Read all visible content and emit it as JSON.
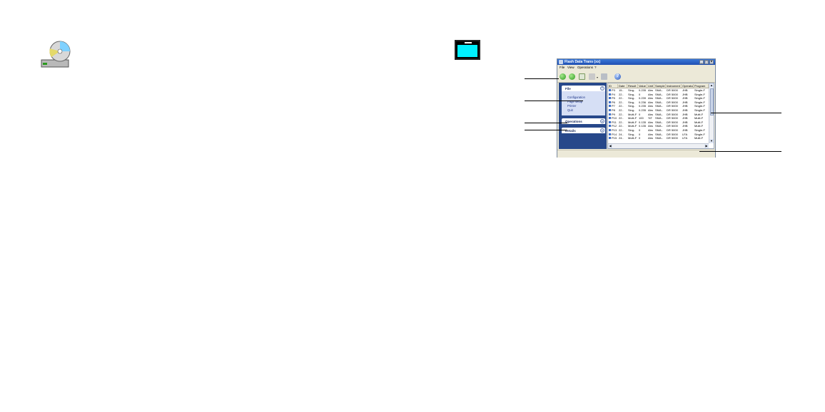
{
  "window": {
    "title": "Flash Data Trans (xx)"
  },
  "menu": [
    "File",
    "View",
    "Operations",
    "?"
  ],
  "nav": {
    "file_group": {
      "label": "File",
      "items": [
        "Configuration",
        "Page setup",
        "Printer",
        "Quit"
      ]
    },
    "operations_group": {
      "label": "Operations"
    },
    "details_group": {
      "label": "Details"
    }
  },
  "table": {
    "columns": [
      "ID",
      "Date",
      "Result",
      "Value",
      "Unit",
      "Sample",
      "Instrument",
      "Operator",
      "Program"
    ],
    "rows": [
      [
        "P3",
        "15..",
        "Sing..",
        "0.235",
        "Abs",
        "SMA..",
        "DR 5000",
        "JHB",
        "Single-F"
      ],
      [
        "P4",
        "22..",
        "Sing..",
        "0",
        "Abs",
        "SMA..",
        "DR 5000",
        "JHB",
        "Single-F"
      ],
      [
        "P5",
        "22..",
        "Sing..",
        "0.239",
        "Abs",
        "SMA..",
        "DR 5000",
        "JHB",
        "Single-F"
      ],
      [
        "P6",
        "22..",
        "Sing..",
        "0.236",
        "Abs",
        "SMA..",
        "DR 5000",
        "JHB",
        "Single-F"
      ],
      [
        "P7",
        "22..",
        "Sing..",
        "0.235",
        "Abs",
        "SMA..",
        "DR 5000",
        "JHB",
        "Single-F"
      ],
      [
        "P8",
        "22..",
        "Sing..",
        "0.235",
        "Abs",
        "SMA..",
        "DR 5000",
        "JHB",
        "Single-F"
      ],
      [
        "P9",
        "22..",
        "Multi-F",
        "0",
        "Abs",
        "SMA..",
        "DR 5000",
        "JHB",
        "Multi-F"
      ],
      [
        "P10",
        "22..",
        "Multi-F",
        "100",
        "%T",
        "SMA..",
        "DR 5000",
        "JHB",
        "Multi-F"
      ],
      [
        "P11",
        "22..",
        "Multi-F",
        "0.135",
        "Abs",
        "SMA..",
        "DR 5000",
        "JHB",
        "Multi-F"
      ],
      [
        "P12",
        "22..",
        "Multi-F",
        "0.135",
        "Abs",
        "SMA..",
        "DR 5000",
        "JHB",
        "Multi-F"
      ],
      [
        "P13",
        "22..",
        "Sing..",
        "0",
        "Abs",
        "SMA..",
        "DR 5000",
        "JHB",
        "Single-F"
      ],
      [
        "P14",
        "24..",
        "Sing..",
        "0",
        "Abs",
        "SMA..",
        "DR 5000",
        "LFA",
        "Single-F"
      ],
      [
        "P15",
        "24..",
        "Multi-F",
        "0",
        "Abs",
        "SMA..",
        "DR 5000",
        "LFA",
        "Multi-F"
      ]
    ]
  },
  "icons": {
    "cd": "cd-disc-icon",
    "window": "window-icon",
    "back": "back-arrow-icon",
    "forward": "forward-arrow-icon",
    "document": "document-icon",
    "tools": "wrench-icon",
    "printer": "printer-icon",
    "help": "help-icon"
  },
  "colors": {
    "nav_background": "#27488a",
    "titlebar": "#1f4fb3",
    "window_icon_fill": "#00f0ff"
  }
}
